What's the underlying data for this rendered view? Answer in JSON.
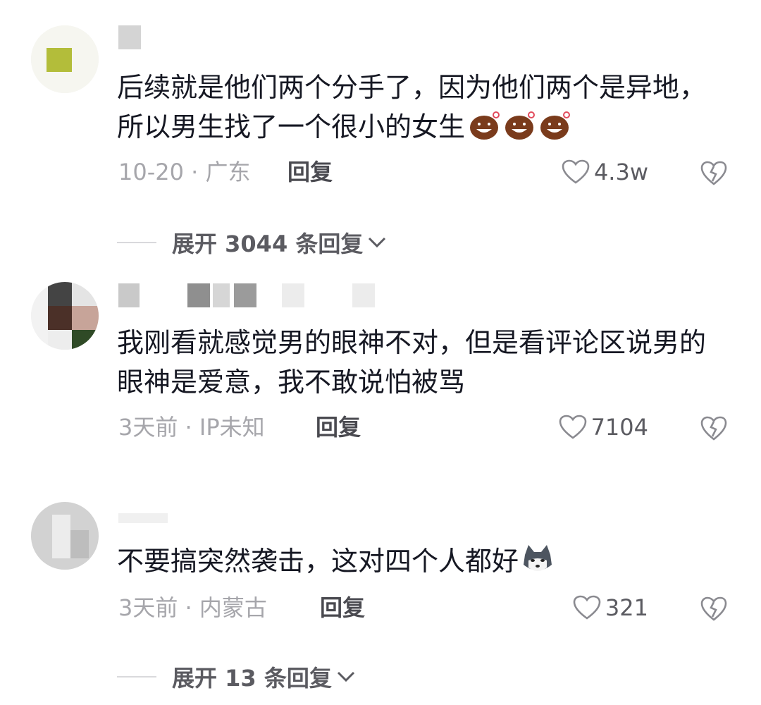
{
  "comments": [
    {
      "text": "后续就是他们两个分手了，因为他们两个是异地，所以男生找了一个很小的女生",
      "emoji": "laughing-face-emoji",
      "date_location": "10-20 · 广东",
      "reply_label": "回复",
      "likes": "4.3w",
      "expand_label": "展开 3044 条回复"
    },
    {
      "text": "我刚看就感觉男的眼神不对，但是看评论区说男的眼神是爱意，我不敢说怕被骂",
      "date_location": "3天前 · IP未知",
      "reply_label": "回复",
      "likes": "7104"
    },
    {
      "text": "不要搞突然袭击，这对四个人都好",
      "emoji": "husky-dog-emoji",
      "date_location": "3天前 · 内蒙古",
      "reply_label": "回复",
      "likes": "321",
      "expand_label": "展开 13 条回复"
    }
  ],
  "icons": {
    "like": "heart-outline-icon",
    "dislike": "broken-heart-icon",
    "expand": "chevron-down-icon"
  },
  "colors": {
    "text": "#161823",
    "meta": "#a6a6ab",
    "action": "#5b5b61"
  }
}
